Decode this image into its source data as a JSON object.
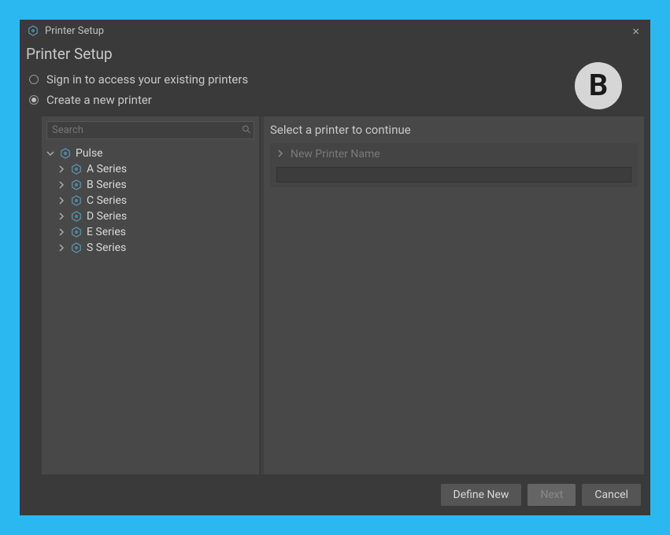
{
  "titlebar": {
    "title": "Printer Setup"
  },
  "header": {
    "title": "Printer Setup",
    "badge": "B"
  },
  "options": {
    "signin": "Sign in to access your existing printers",
    "create": "Create a new printer"
  },
  "search": {
    "placeholder": "Search"
  },
  "tree": {
    "root": "Pulse",
    "series": [
      "A Series",
      "B Series",
      "C Series",
      "D Series",
      "E Series",
      "S Series"
    ]
  },
  "right": {
    "heading": "Select a printer to continue",
    "name_label": "New Printer Name"
  },
  "footer": {
    "defineNew": "Define New",
    "next": "Next",
    "cancel": "Cancel"
  }
}
